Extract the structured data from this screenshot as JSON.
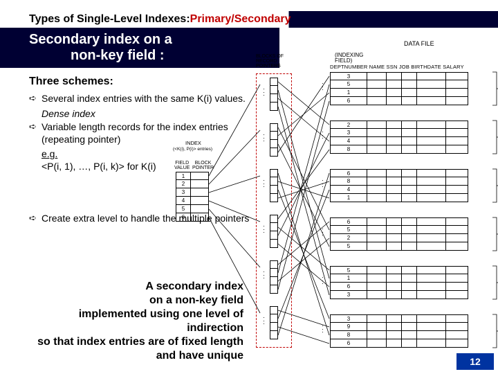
{
  "title": {
    "prefix": "Types of Single-Level Indexes: ",
    "primary": "Primary",
    "sep": " / ",
    "secondary": "Secondary"
  },
  "sub": {
    "line1": "Secondary index on a",
    "line2": "non-key field :"
  },
  "schemes_heading": "Three schemes:",
  "bullets": {
    "b1": "Several index entries with the same K(i) values.",
    "b1_dense": "Dense index",
    "b2": "Variable length records for the index entries (repeating pointer)",
    "b2_eg": "e.g.",
    "b2_p": "<P(i, 1), …, P(i, k)> for K(i)",
    "b3": "Create extra level to handle the multiple pointers"
  },
  "summary": {
    "l1": "A secondary index",
    "l2": "on a non-key field",
    "l3": "implemented using one level of indirection",
    "l4": "so that index entries are of fixed length and have unique"
  },
  "page_number": "12",
  "diagram": {
    "data_file_label": "DATA FILE",
    "indexing_field_label": "(INDEXING\nFIELD)",
    "data_header": "DEPTNUMBER NAME  SSN  JOB  BIRTHDATE  SALARY",
    "index_box_label": "INDEX",
    "index_box_sub": "(<K(i), P(i)> entries)",
    "field_value_label": "FIELD\nVALUE",
    "block_pointer_label": "BLOCK\nPOINTER",
    "blocks_rec_ptr_label": "BLOCKS OF\nRECORD\nPOINTERS",
    "index_values": [
      "1",
      "2",
      "3",
      "4",
      "5",
      "6"
    ],
    "data_blocks": [
      {
        "dept": [
          "3",
          "5",
          "1",
          "6"
        ]
      },
      {
        "dept": [
          "2",
          "3",
          "4",
          "8"
        ]
      },
      {
        "dept": [
          "6",
          "8",
          "4",
          "1"
        ]
      },
      {
        "dept": [
          "6",
          "5",
          "2",
          "5"
        ]
      },
      {
        "dept": [
          "5",
          "1",
          "6",
          "3"
        ]
      },
      {
        "dept": [
          "3",
          "9",
          "8",
          "6"
        ]
      }
    ]
  }
}
